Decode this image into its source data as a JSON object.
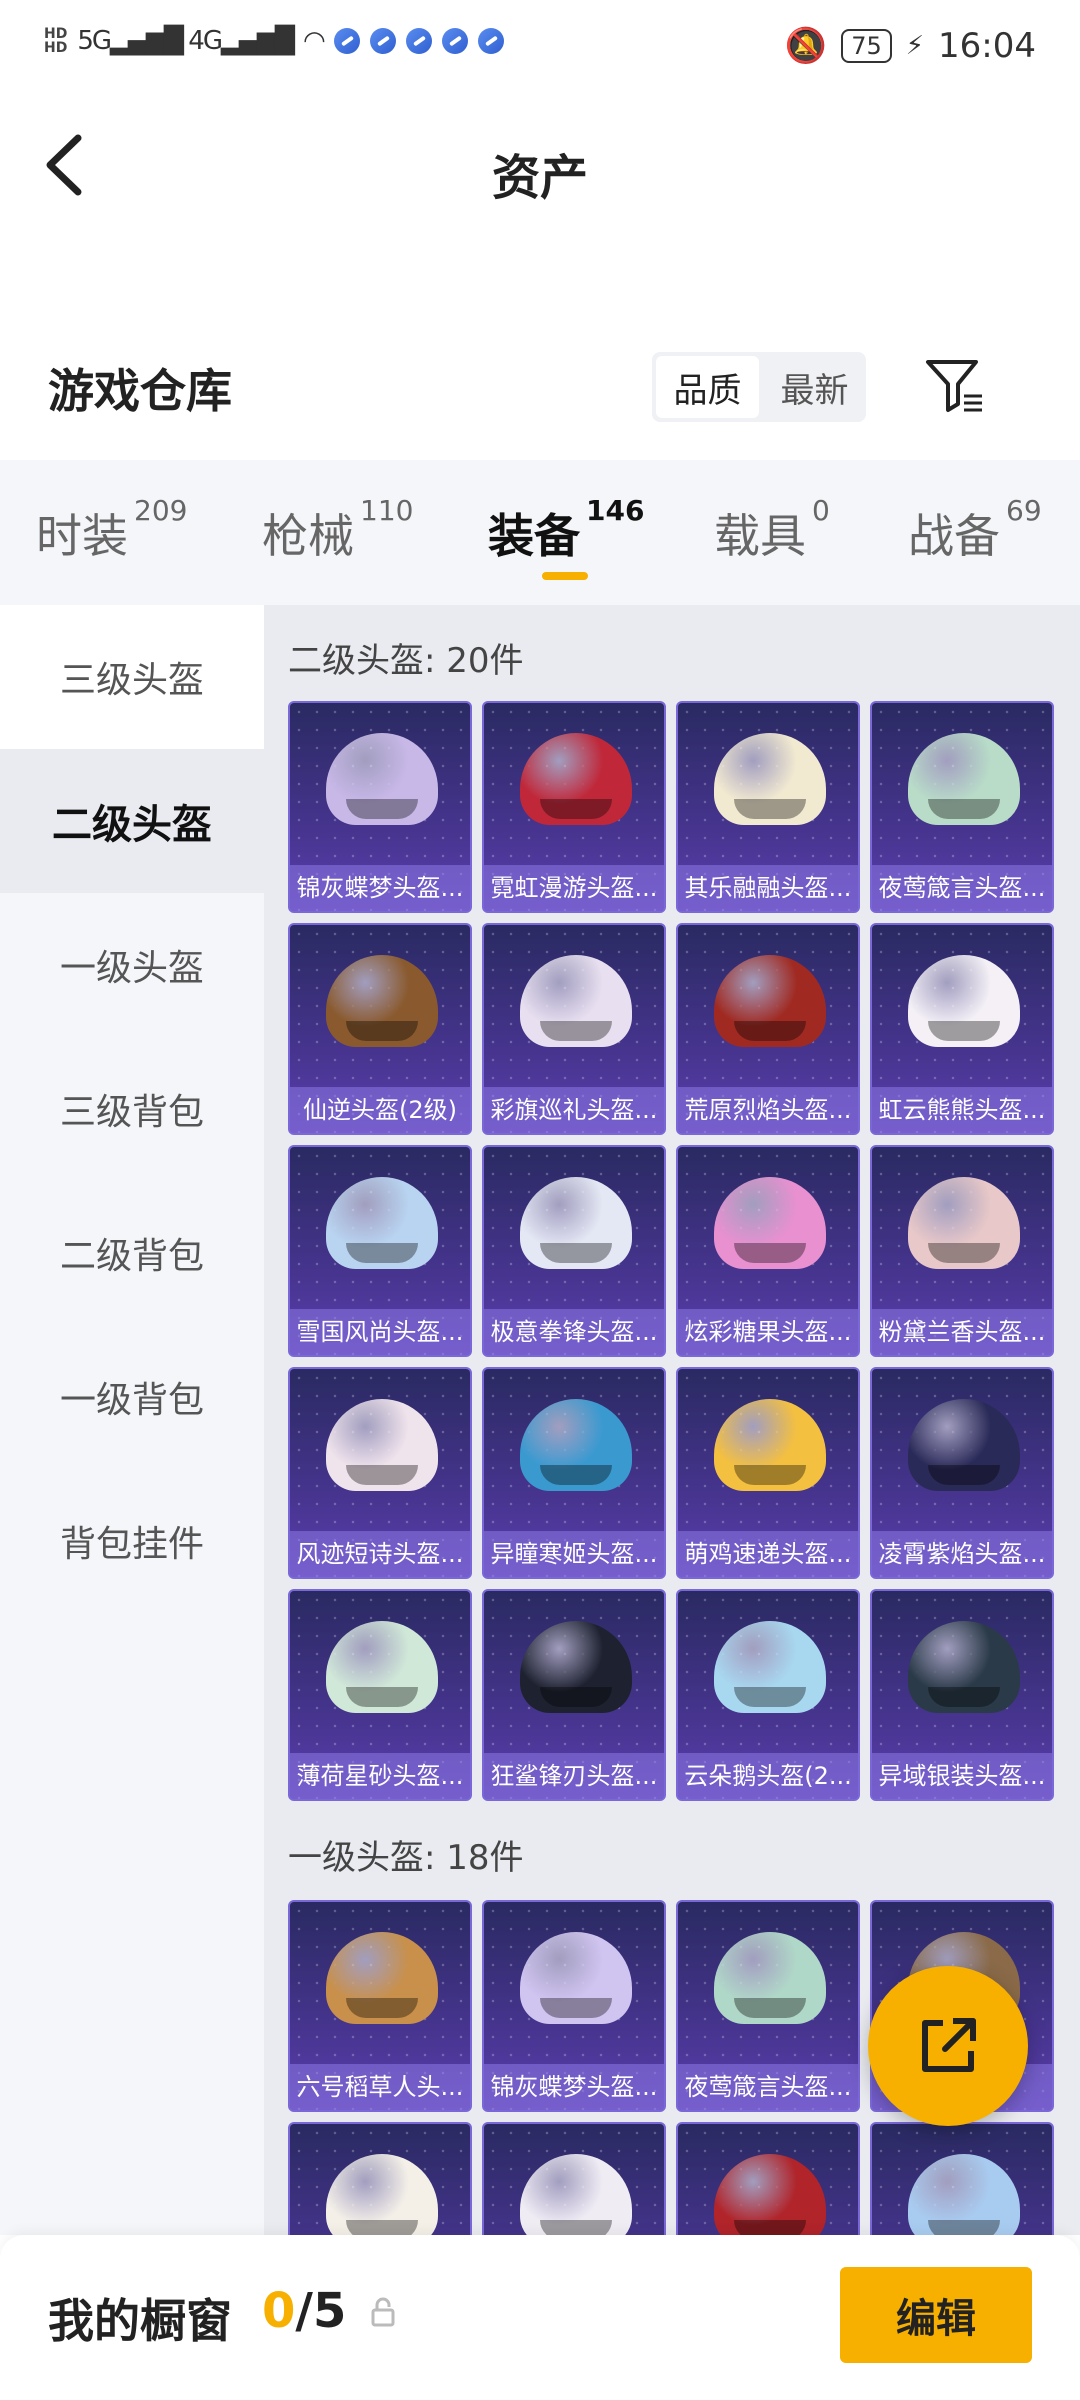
{
  "status_bar": {
    "network": "5G 4G",
    "time": "16:04",
    "battery": "75"
  },
  "header": {
    "title": "资产"
  },
  "warehouse": {
    "title": "游戏仓库",
    "sort_options": [
      "品质",
      "最新"
    ],
    "sort_selected": "品质"
  },
  "tabs": [
    {
      "label": "时装",
      "count": "209"
    },
    {
      "label": "枪械",
      "count": "110"
    },
    {
      "label": "装备",
      "count": "146"
    },
    {
      "label": "载具",
      "count": "0"
    },
    {
      "label": "战备",
      "count": "69"
    }
  ],
  "active_tab": "装备",
  "sidebar": {
    "items": [
      "三级头盔",
      "二级头盔",
      "一级头盔",
      "三级背包",
      "二级背包",
      "一级背包",
      "背包挂件"
    ],
    "active": "二级头盔"
  },
  "sections": [
    {
      "title": "二级头盔: 20件",
      "items": [
        {
          "name": "锦灰蝶梦头盔...",
          "color": "#c8b8e8"
        },
        {
          "name": "霓虹漫游头盔...",
          "color": "#c0283a"
        },
        {
          "name": "其乐融融头盔...",
          "color": "#f2ead0"
        },
        {
          "name": "夜莺箴言头盔...",
          "color": "#b8dcc8"
        },
        {
          "name": "仙逆头盔(2级)",
          "color": "#8a5a2e"
        },
        {
          "name": "彩旗巡礼头盔...",
          "color": "#e8e0f0"
        },
        {
          "name": "荒原烈焰头盔...",
          "color": "#a02a22"
        },
        {
          "name": "虹云熊熊头盔...",
          "color": "#f4f0f6"
        },
        {
          "name": "雪国风尚头盔...",
          "color": "#b8d4f0"
        },
        {
          "name": "极意拳锋头盔...",
          "color": "#e4e8f4"
        },
        {
          "name": "炫彩糖果头盔...",
          "color": "#e890d0"
        },
        {
          "name": "粉黛兰香头盔...",
          "color": "#e8c8c8"
        },
        {
          "name": "风迹短诗头盔...",
          "color": "#f0e4ec"
        },
        {
          "name": "异瞳寒姬头盔...",
          "color": "#3a9ad0"
        },
        {
          "name": "萌鸡速递头盔...",
          "color": "#f4c040"
        },
        {
          "name": "凌霄紫焰头盔...",
          "color": "#2a2a58"
        },
        {
          "name": "薄荷星砂头盔...",
          "color": "#d0e8d8"
        },
        {
          "name": "狂鲨锋刃头盔...",
          "color": "#1e2230"
        },
        {
          "name": "云朵鹅头盔(2...",
          "color": "#a8d8f0"
        },
        {
          "name": "异域银装头盔...",
          "color": "#2a3a48"
        }
      ]
    },
    {
      "title": "一级头盔: 18件",
      "items": [
        {
          "name": "六号稻草人头...",
          "color": "#c8904a"
        },
        {
          "name": "锦灰蝶梦头盔...",
          "color": "#d0c4f0"
        },
        {
          "name": "夜莺箴言头盔...",
          "color": "#b0d8c8"
        },
        {
          "name": "...)",
          "color": "#8a6a48"
        },
        {
          "name": "",
          "color": "#f4f0e8"
        },
        {
          "name": "",
          "color": "#f0ecf4"
        },
        {
          "name": "",
          "color": "#b0242a"
        },
        {
          "name": "",
          "color": "#a8ccf0"
        }
      ]
    }
  ],
  "bottom_bar": {
    "showcase_label": "我的橱窗",
    "count_current": "0",
    "count_total": "/5",
    "edit_label": "编辑"
  },
  "colors": {
    "accent": "#f7b000",
    "card_border": "#7a68d8"
  }
}
